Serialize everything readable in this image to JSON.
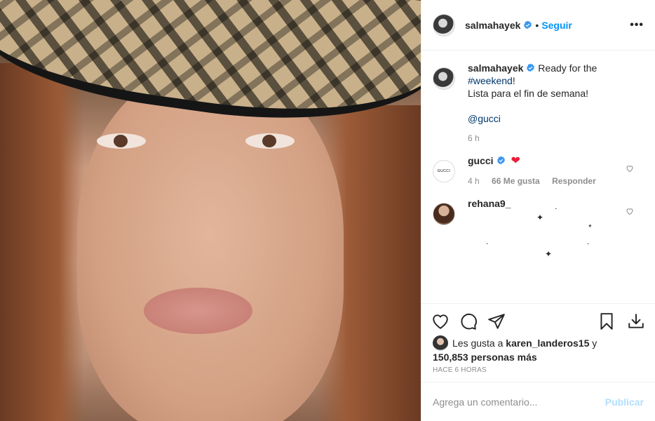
{
  "post": {
    "author": "salmahayek",
    "separator": "•",
    "follow_label": "Seguir",
    "more_label": "•••",
    "caption": {
      "text_1": "Ready for the",
      "hashtag": "#weekend",
      "exclaim": "!",
      "line_2": "Lista para el fin de semana!",
      "mention": "@gucci",
      "time": "6 h"
    }
  },
  "comments": [
    {
      "user": "gucci",
      "avatar_text": "GUCCI",
      "heart_emoji": "❤",
      "time": "4 h",
      "likes": "66 Me gusta",
      "reply": "Responder"
    },
    {
      "user": "rehana9_",
      "stars": [
        "✦",
        ".",
        "*",
        ".",
        ".",
        "✦"
      ]
    }
  ],
  "likes": {
    "prefix": "Les gusta a",
    "user": "karen_landeros15",
    "conj": "y",
    "count": "150,853 personas más"
  },
  "timestamp": "HACE 6 HORAS",
  "add_comment": {
    "placeholder": "Agrega un comentario...",
    "post_label": "Publicar"
  },
  "colors": {
    "accent": "#0095f6",
    "verified": "#3897f0",
    "heart": "#ed4956",
    "post_disabled": "#b2dffc"
  },
  "icons": [
    "verified-badge-icon",
    "heart-icon",
    "comment-icon",
    "share-icon",
    "bookmark-icon",
    "download-icon",
    "small-heart-icon"
  ]
}
